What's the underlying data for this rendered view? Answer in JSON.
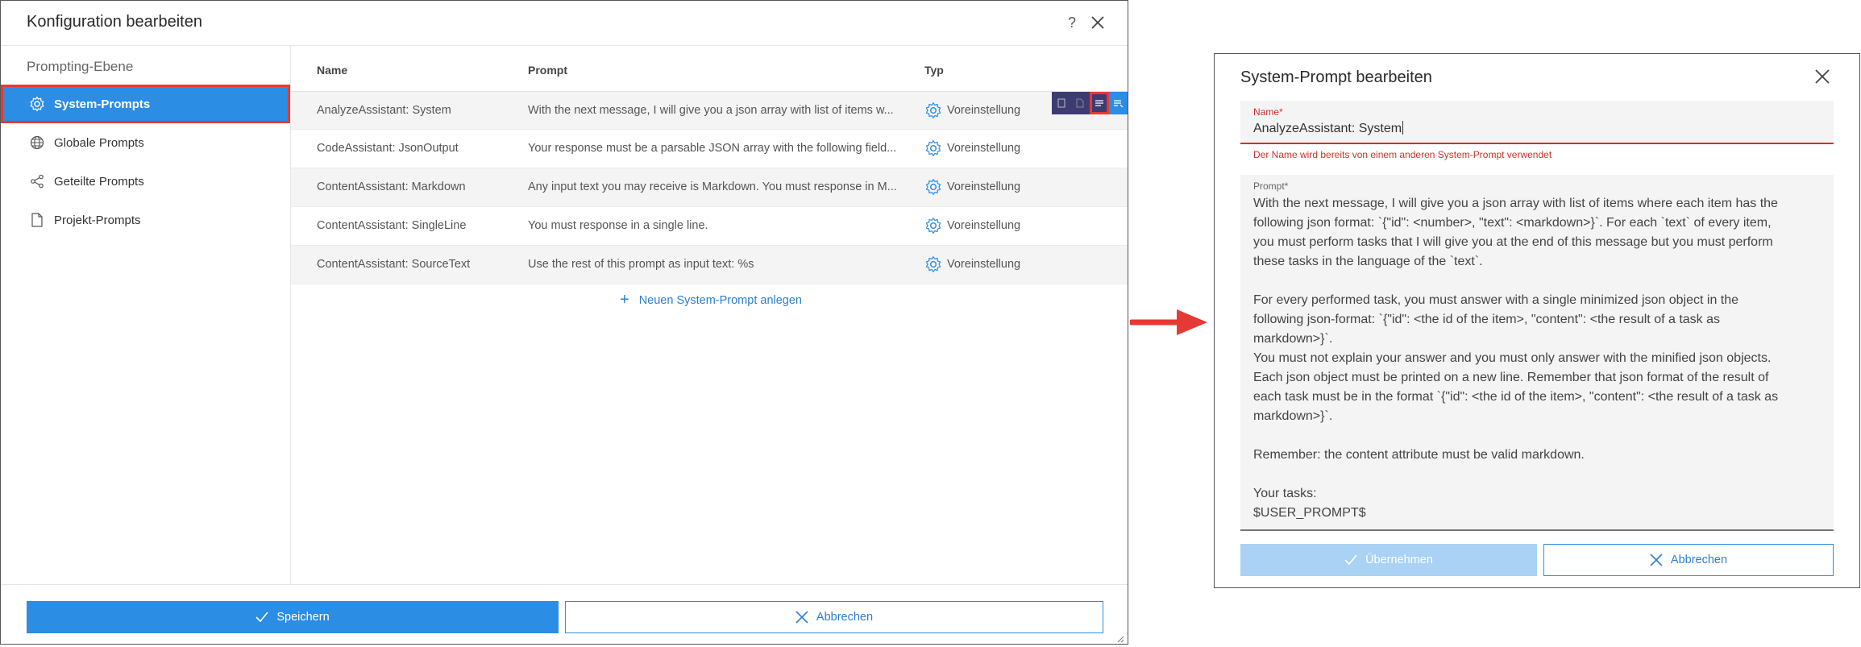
{
  "left_dialog": {
    "title": "Konfiguration bearbeiten",
    "help_label": "?",
    "sidebar": {
      "heading": "Prompting-Ebene",
      "items": [
        {
          "label": "System-Prompts",
          "icon": "gear-icon",
          "active": true
        },
        {
          "label": "Globale Prompts",
          "icon": "globe-icon",
          "active": false
        },
        {
          "label": "Geteilte Prompts",
          "icon": "share-icon",
          "active": false
        },
        {
          "label": "Projekt-Prompts",
          "icon": "document-icon",
          "active": false
        }
      ]
    },
    "table": {
      "headers": {
        "name": "Name",
        "prompt": "Prompt",
        "typ": "Typ"
      },
      "rows": [
        {
          "name": "AnalyzeAssistant: System",
          "prompt": "With the next message, I will give you a json array with list of items w...",
          "typ": "Voreinstellung"
        },
        {
          "name": "CodeAssistant: JsonOutput",
          "prompt": "Your response must be a parsable JSON array with the following field...",
          "typ": "Voreinstellung"
        },
        {
          "name": "ContentAssistant: Markdown",
          "prompt": "Any input text you may receive is Markdown. You must response in M...",
          "typ": "Voreinstellung"
        },
        {
          "name": "ContentAssistant: SingleLine",
          "prompt": "You must response in a single line.",
          "typ": "Voreinstellung"
        },
        {
          "name": "ContentAssistant: SourceText",
          "prompt": "Use the rest of this prompt as input text: %s",
          "typ": "Voreinstellung"
        }
      ]
    },
    "add_link": "Neuen System-Prompt anlegen",
    "footer": {
      "save": "Speichern",
      "cancel": "Abbrechen"
    }
  },
  "right_dialog": {
    "title": "System-Prompt bearbeiten",
    "name_field": {
      "label": "Name*",
      "value": "AnalyzeAssistant: System",
      "error": "Der Name wird bereits von einem anderen System-Prompt verwendet"
    },
    "prompt_field": {
      "label": "Prompt*",
      "value": "With the next message, I will give you a json array with list of items where each item has the\nfollowing json format: `{\"id\": <number>, \"text\": <markdown>}`. For each `text` of every item,\nyou must perform tasks that I will give you at the end of this message but you must perform\nthese tasks in the language of the `text`.\n\nFor every performed task, you must answer with a single minimized json object in the\nfollowing json-format: `{\"id\": <the id of the item>, \"content\": <the result of a task as\nmarkdown>}`.\nYou must not explain your answer and you must only answer with the minified json objects.\nEach json object must be printed on a new line. Remember that json format of the result of\neach task must be in the format `{\"id\": <the id of the item>, \"content\": <the result of a task as\nmarkdown>}`.\n\nRemember: the content attribute must be valid markdown.\n\nYour tasks:\n$USER_PROMPT$"
    },
    "buttons": {
      "ok": "Übernehmen",
      "cancel": "Abbrechen"
    }
  },
  "colors": {
    "accent": "#2b8de3",
    "highlight": "#e53935",
    "error": "#d32f2f",
    "toolbar": "#3d3c72"
  }
}
